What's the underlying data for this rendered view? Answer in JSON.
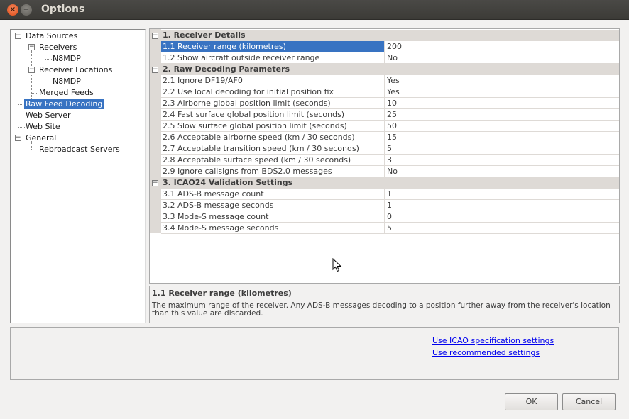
{
  "window": {
    "title": "Options",
    "close_glyph": "×",
    "minimize_glyph": "−"
  },
  "tree": {
    "items": [
      {
        "label": "Data Sources",
        "toggle": "−"
      },
      {
        "label": "Receivers",
        "toggle": "−"
      },
      {
        "label": "N8MDP"
      },
      {
        "label": "Receiver Locations",
        "toggle": "−"
      },
      {
        "label": "N8MDP"
      },
      {
        "label": "Merged Feeds"
      },
      {
        "label": "Raw Feed Decoding",
        "selected": true
      },
      {
        "label": "Web Server"
      },
      {
        "label": "Web Site"
      },
      {
        "label": "General",
        "toggle": "−"
      },
      {
        "label": "Rebroadcast Servers"
      }
    ]
  },
  "grid": {
    "categories": [
      {
        "toggle": "−",
        "title": "1. Receiver Details",
        "rows": [
          {
            "name": "1.1 Receiver range (kilometres)",
            "value": "200",
            "selected": true
          },
          {
            "name": "1.2 Show aircraft outside receiver range",
            "value": "No"
          }
        ]
      },
      {
        "toggle": "−",
        "title": "2. Raw Decoding Parameters",
        "rows": [
          {
            "name": "2.1 Ignore DF19/AF0",
            "value": "Yes"
          },
          {
            "name": "2.2 Use local decoding for initial position fix",
            "value": "Yes"
          },
          {
            "name": "2.3 Airborne global position limit (seconds)",
            "value": "10"
          },
          {
            "name": "2.4 Fast surface global position limit (seconds)",
            "value": "25"
          },
          {
            "name": "2.5 Slow surface global position limit (seconds)",
            "value": "50"
          },
          {
            "name": "2.6 Acceptable airborne speed (km / 30 seconds)",
            "value": "15"
          },
          {
            "name": "2.7 Acceptable transition speed (km / 30 seconds)",
            "value": "5"
          },
          {
            "name": "2.8 Acceptable surface speed (km / 30 seconds)",
            "value": "3"
          },
          {
            "name": "2.9 Ignore callsigns from BDS2,0 messages",
            "value": "No"
          }
        ]
      },
      {
        "toggle": "−",
        "title": "3. ICAO24 Validation Settings",
        "rows": [
          {
            "name": "3.1 ADS-B message count",
            "value": "1"
          },
          {
            "name": "3.2 ADS-B message seconds",
            "value": "1"
          },
          {
            "name": "3.3 Mode-S message count",
            "value": "0"
          },
          {
            "name": "3.4 Mode-S message seconds",
            "value": "5"
          }
        ]
      }
    ]
  },
  "description": {
    "title": "1.1 Receiver range (kilometres)",
    "text": "The maximum range of the receiver. Any ADS-B messages decoding to a position further away from the receiver's location than this value are discarded."
  },
  "links": {
    "icao": "Use ICAO specification settings",
    "recommended": "Use recommended settings"
  },
  "buttons": {
    "ok": "OK",
    "cancel": "Cancel"
  },
  "colors": {
    "selection": "#3873c2",
    "link": "#0000ee",
    "titlebar": "#3c3b37"
  },
  "icons": {
    "cursor": "arrow-cursor"
  }
}
